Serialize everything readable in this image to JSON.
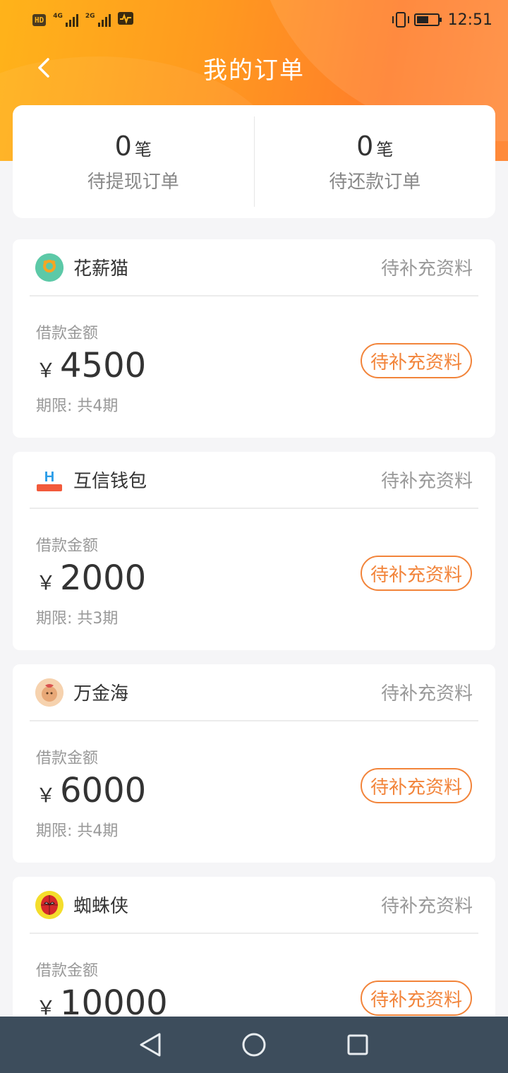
{
  "status_bar": {
    "tag": "HD",
    "signal1_label": "4G",
    "signal2_label": "2G",
    "time": "12:51",
    "battery_level": 0.6
  },
  "header": {
    "title": "我的订单"
  },
  "summary": {
    "withdraw": {
      "count": "0",
      "unit": "笔",
      "label": "待提现订单"
    },
    "repay": {
      "count": "0",
      "unit": "笔",
      "label": "待还款订单"
    }
  },
  "orders": [
    {
      "name": "花薪猫",
      "status": "待补充资料",
      "amount_label": "借款金额",
      "currency": "￥",
      "amount": "4500",
      "term": "期限: 共4期",
      "action": "待补充资料",
      "logo_icon": "huaxinmao-logo-icon"
    },
    {
      "name": "互信钱包",
      "status": "待补充资料",
      "amount_label": "借款金额",
      "currency": "￥",
      "amount": "2000",
      "term": "期限: 共3期",
      "action": "待补充资料",
      "logo_icon": "huxin-wallet-logo-icon"
    },
    {
      "name": "万金海",
      "status": "待补充资料",
      "amount_label": "借款金额",
      "currency": "￥",
      "amount": "6000",
      "term": "期限: 共4期",
      "action": "待补充资料",
      "logo_icon": "wanjinhai-logo-icon"
    },
    {
      "name": "蜘蛛侠",
      "status": "待补充资料",
      "amount_label": "借款金额",
      "currency": "￥",
      "amount": "10000",
      "term": "",
      "action": "待补充资料",
      "logo_icon": "spiderman-logo-icon"
    }
  ],
  "colors": {
    "accent": "#f2843a",
    "header_gradient_start": "#ffb31a",
    "header_gradient_end": "#ff7d2a",
    "nav_bar": "#3d4d5c"
  }
}
